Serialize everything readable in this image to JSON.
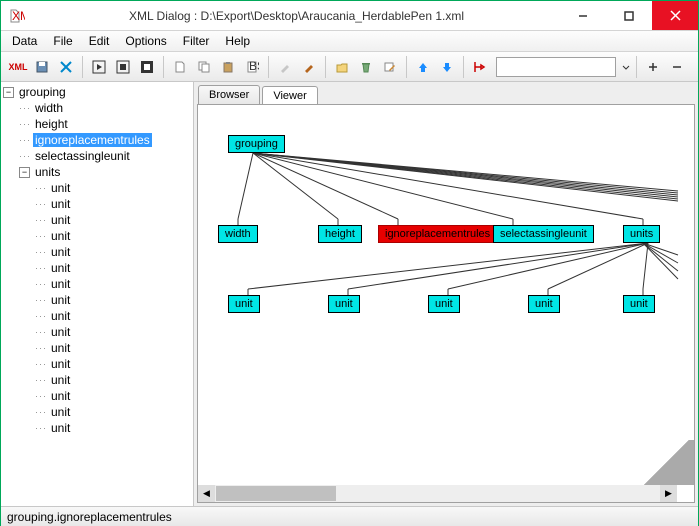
{
  "window": {
    "title": "XML Dialog : D:\\Export\\Desktop\\Araucania_HerdablePen 1.xml"
  },
  "menu": {
    "data": "Data",
    "file": "File",
    "edit": "Edit",
    "options": "Options",
    "filter": "Filter",
    "help": "Help"
  },
  "toolbar": {
    "xml": "XML"
  },
  "tree": {
    "root": "grouping",
    "children": [
      "width",
      "height",
      "ignoreplacementrules",
      "selectassingleunit"
    ],
    "units": "units",
    "unit_label": "unit",
    "unit_count": 16,
    "selected": "ignoreplacementrules"
  },
  "tabs": {
    "browser": "Browser",
    "viewer": "Viewer"
  },
  "graph": {
    "grouping": "grouping",
    "width": "width",
    "height": "height",
    "ignore": "ignoreplacementrules",
    "select": "selectassingleunit",
    "units": "units",
    "unit": "unit"
  },
  "status": {
    "path": "grouping.ignoreplacementrules"
  }
}
